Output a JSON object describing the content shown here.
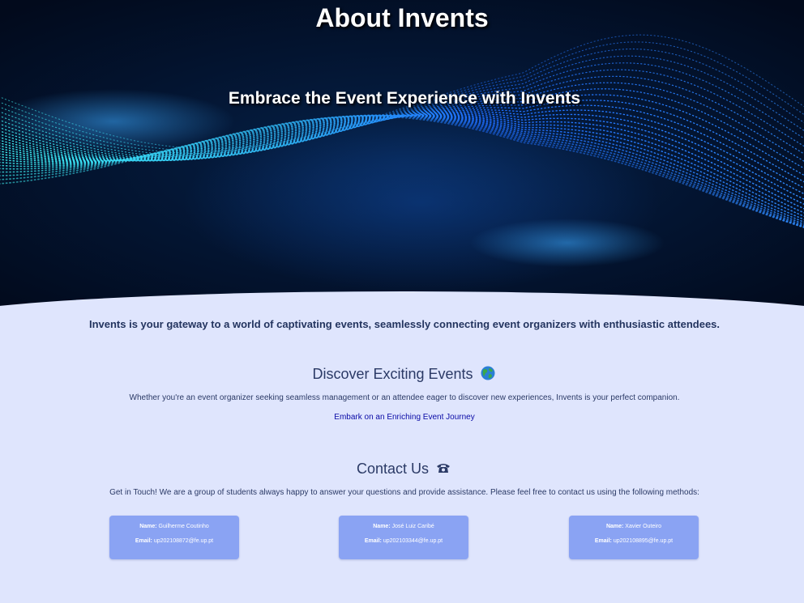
{
  "hero": {
    "title": "About Invents",
    "subtitle": "Embrace the Event Experience with Invents"
  },
  "intro": "Invents is your gateway to a world of captivating events, seamlessly connecting event organizers with enthusiastic attendees.",
  "discover": {
    "title": "Discover Exciting Events",
    "icon": "globe-icon",
    "text": "Whether you're an event organizer seeking seamless management or an attendee eager to discover new experiences, Invents is your perfect companion.",
    "link_label": "Embark on an Enriching Event Journey"
  },
  "contact": {
    "title": "Contact Us",
    "icon": "telephone-icon",
    "text": "Get in Touch! We are a group of students always happy to answer your questions and provide assistance. Please feel free to contact us using the following methods:",
    "name_label": "Name:",
    "email_label": "Email:",
    "members": [
      {
        "name": "Guilherme Coutinho",
        "email": "up202108872@fe.up.pt"
      },
      {
        "name": "José Luiz Caribé",
        "email": "up202103344@fe.up.pt"
      },
      {
        "name": "Xavier Outeiro",
        "email": "up202108895@fe.up.pt"
      }
    ]
  },
  "colors": {
    "hero_background": "#031430",
    "wave_cyan": "#3ef0f0",
    "wave_blue": "#1d6cff",
    "page_background": "#dfe5fd",
    "card_background": "#8aa3f3",
    "text": "#2b3a66",
    "link": "#0a0aa6"
  }
}
